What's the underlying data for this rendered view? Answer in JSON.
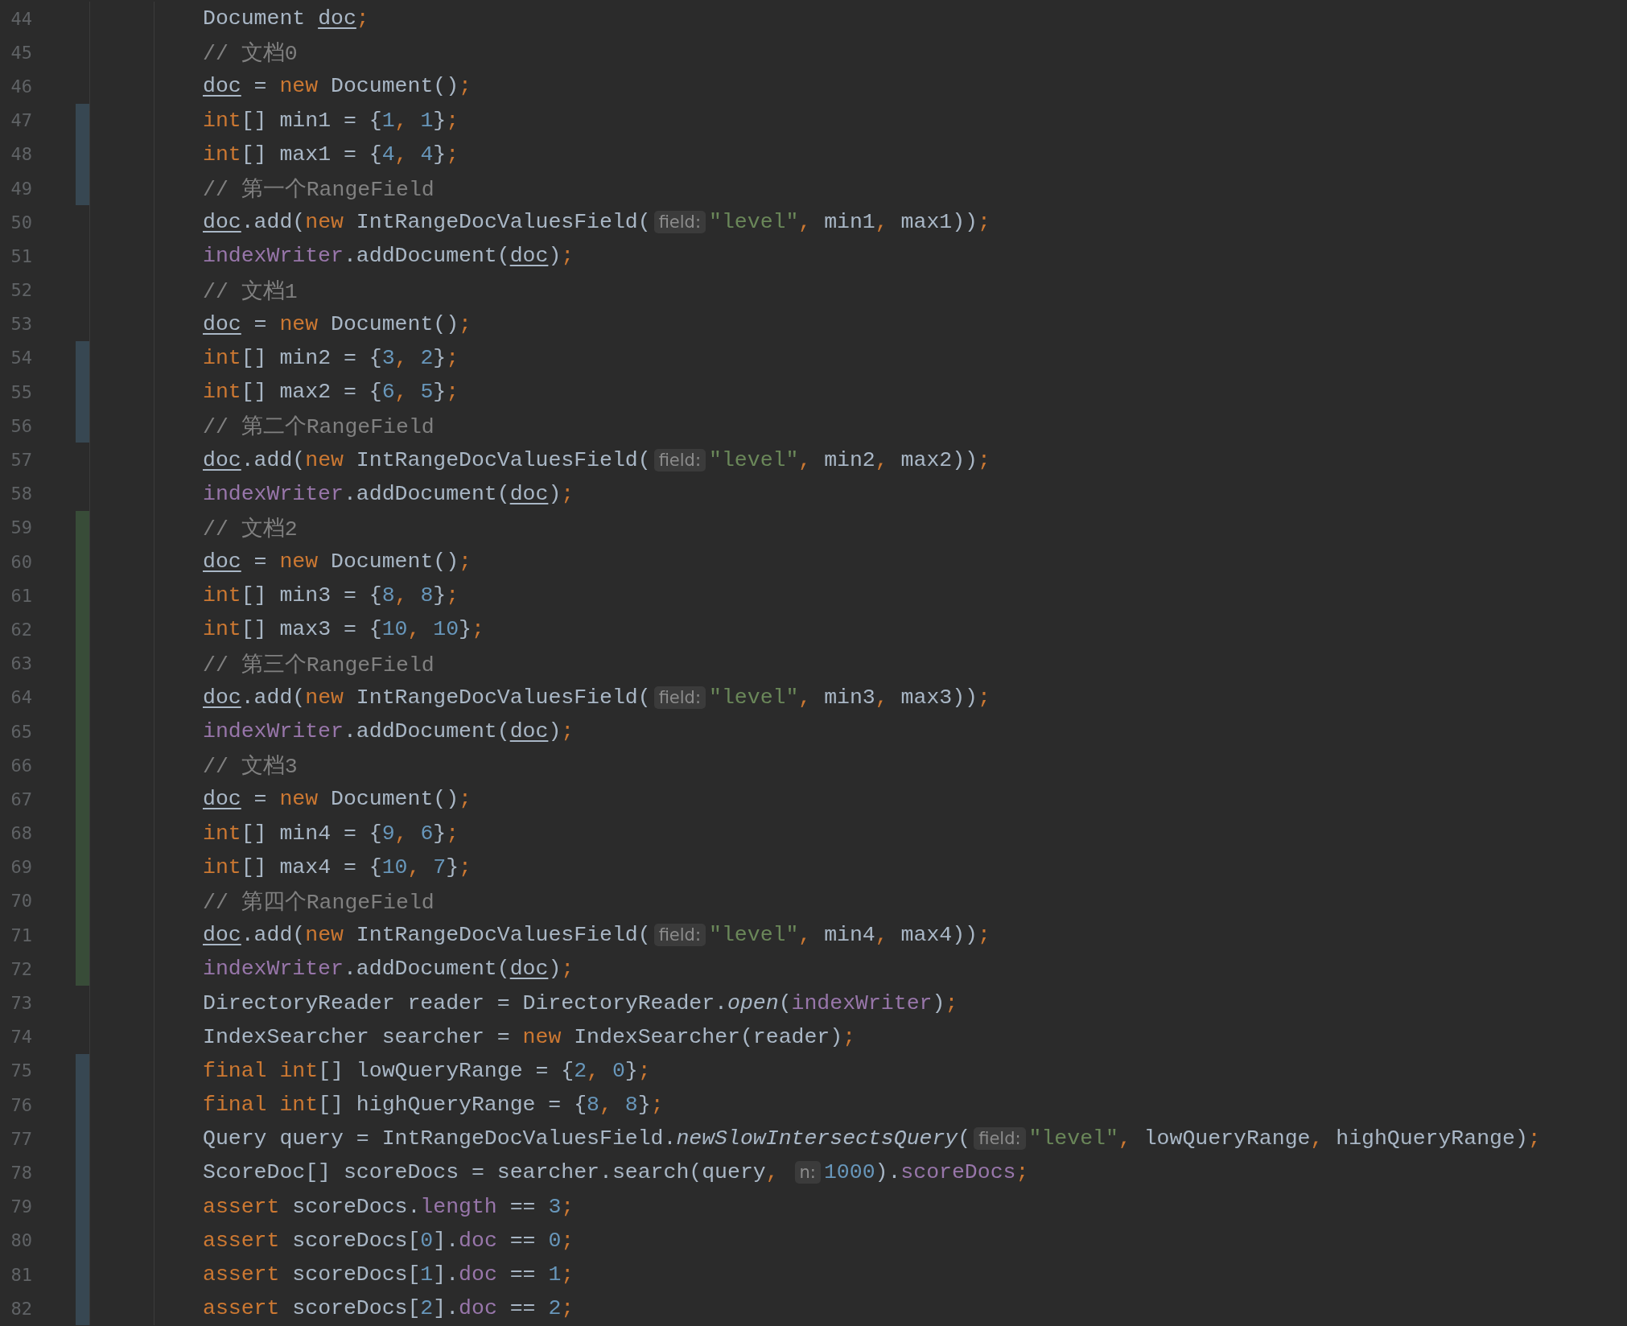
{
  "editor": {
    "lines": [
      {
        "number": "44",
        "kind": "unchanged",
        "tokens": [
          {
            "kind": "plain",
            "text": "Document "
          },
          {
            "kind": "var",
            "text": "doc"
          },
          {
            "kind": "punct",
            "text": ";"
          }
        ]
      },
      {
        "number": "45",
        "kind": "unchanged",
        "tokens": [
          {
            "kind": "comment",
            "text": "// 文档0"
          }
        ]
      },
      {
        "number": "46",
        "kind": "unchanged",
        "tokens": [
          {
            "kind": "var",
            "text": "doc"
          },
          {
            "kind": "plain",
            "text": " = "
          },
          {
            "kind": "keyword",
            "text": "new"
          },
          {
            "kind": "plain",
            "text": " Document()"
          },
          {
            "kind": "punct",
            "text": ";"
          }
        ]
      },
      {
        "number": "47",
        "kind": "modified",
        "tokens": [
          {
            "kind": "keyword",
            "text": "int"
          },
          {
            "kind": "plain",
            "text": "[] min1 = {"
          },
          {
            "kind": "number",
            "text": "1"
          },
          {
            "kind": "punct",
            "text": ", "
          },
          {
            "kind": "number",
            "text": "1"
          },
          {
            "kind": "plain",
            "text": "}"
          },
          {
            "kind": "punct",
            "text": ";"
          }
        ]
      },
      {
        "number": "48",
        "kind": "modified",
        "tokens": [
          {
            "kind": "keyword",
            "text": "int"
          },
          {
            "kind": "plain",
            "text": "[] max1 = {"
          },
          {
            "kind": "number",
            "text": "4"
          },
          {
            "kind": "punct",
            "text": ", "
          },
          {
            "kind": "number",
            "text": "4"
          },
          {
            "kind": "plain",
            "text": "}"
          },
          {
            "kind": "punct",
            "text": ";"
          }
        ]
      },
      {
        "number": "49",
        "kind": "modified",
        "tokens": [
          {
            "kind": "comment",
            "text": "// 第一个RangeField"
          }
        ]
      },
      {
        "number": "50",
        "kind": "unchanged",
        "tokens": [
          {
            "kind": "var",
            "text": "doc"
          },
          {
            "kind": "plain",
            "text": ".add("
          },
          {
            "kind": "keyword",
            "text": "new"
          },
          {
            "kind": "plain",
            "text": " IntRangeDocValuesField("
          },
          {
            "kind": "hint",
            "text": "field:"
          },
          {
            "kind": "string",
            "text": "\"level\""
          },
          {
            "kind": "punct",
            "text": ", "
          },
          {
            "kind": "plain",
            "text": "min1"
          },
          {
            "kind": "punct",
            "text": ", "
          },
          {
            "kind": "plain",
            "text": "max1))"
          },
          {
            "kind": "punct",
            "text": ";"
          }
        ]
      },
      {
        "number": "51",
        "kind": "unchanged",
        "tokens": [
          {
            "kind": "field",
            "text": "indexWriter"
          },
          {
            "kind": "plain",
            "text": ".addDocument("
          },
          {
            "kind": "var",
            "text": "doc"
          },
          {
            "kind": "plain",
            "text": ")"
          },
          {
            "kind": "punct",
            "text": ";"
          }
        ]
      },
      {
        "number": "52",
        "kind": "unchanged",
        "tokens": [
          {
            "kind": "comment",
            "text": "// 文档1"
          }
        ]
      },
      {
        "number": "53",
        "kind": "unchanged",
        "tokens": [
          {
            "kind": "var",
            "text": "doc"
          },
          {
            "kind": "plain",
            "text": " = "
          },
          {
            "kind": "keyword",
            "text": "new"
          },
          {
            "kind": "plain",
            "text": " Document()"
          },
          {
            "kind": "punct",
            "text": ";"
          }
        ]
      },
      {
        "number": "54",
        "kind": "modified",
        "tokens": [
          {
            "kind": "keyword",
            "text": "int"
          },
          {
            "kind": "plain",
            "text": "[] min2 = {"
          },
          {
            "kind": "number",
            "text": "3"
          },
          {
            "kind": "punct",
            "text": ", "
          },
          {
            "kind": "number",
            "text": "2"
          },
          {
            "kind": "plain",
            "text": "}"
          },
          {
            "kind": "punct",
            "text": ";"
          }
        ]
      },
      {
        "number": "55",
        "kind": "modified",
        "tokens": [
          {
            "kind": "keyword",
            "text": "int"
          },
          {
            "kind": "plain",
            "text": "[] max2 = {"
          },
          {
            "kind": "number",
            "text": "6"
          },
          {
            "kind": "punct",
            "text": ", "
          },
          {
            "kind": "number",
            "text": "5"
          },
          {
            "kind": "plain",
            "text": "}"
          },
          {
            "kind": "punct",
            "text": ";"
          }
        ]
      },
      {
        "number": "56",
        "kind": "modified",
        "tokens": [
          {
            "kind": "comment",
            "text": "// 第二个RangeField"
          }
        ]
      },
      {
        "number": "57",
        "kind": "unchanged",
        "tokens": [
          {
            "kind": "var",
            "text": "doc"
          },
          {
            "kind": "plain",
            "text": ".add("
          },
          {
            "kind": "keyword",
            "text": "new"
          },
          {
            "kind": "plain",
            "text": " IntRangeDocValuesField("
          },
          {
            "kind": "hint",
            "text": "field:"
          },
          {
            "kind": "string",
            "text": "\"level\""
          },
          {
            "kind": "punct",
            "text": ", "
          },
          {
            "kind": "plain",
            "text": "min2"
          },
          {
            "kind": "punct",
            "text": ", "
          },
          {
            "kind": "plain",
            "text": "max2))"
          },
          {
            "kind": "punct",
            "text": ";"
          }
        ]
      },
      {
        "number": "58",
        "kind": "unchanged",
        "tokens": [
          {
            "kind": "field",
            "text": "indexWriter"
          },
          {
            "kind": "plain",
            "text": ".addDocument("
          },
          {
            "kind": "var",
            "text": "doc"
          },
          {
            "kind": "plain",
            "text": ")"
          },
          {
            "kind": "punct",
            "text": ";"
          }
        ]
      },
      {
        "number": "59",
        "kind": "added",
        "tokens": [
          {
            "kind": "comment",
            "text": "// 文档2"
          }
        ]
      },
      {
        "number": "60",
        "kind": "added",
        "tokens": [
          {
            "kind": "var",
            "text": "doc"
          },
          {
            "kind": "plain",
            "text": " = "
          },
          {
            "kind": "keyword",
            "text": "new"
          },
          {
            "kind": "plain",
            "text": " Document()"
          },
          {
            "kind": "punct",
            "text": ";"
          }
        ]
      },
      {
        "number": "61",
        "kind": "added",
        "tokens": [
          {
            "kind": "keyword",
            "text": "int"
          },
          {
            "kind": "plain",
            "text": "[] min3 = {"
          },
          {
            "kind": "number",
            "text": "8"
          },
          {
            "kind": "punct",
            "text": ", "
          },
          {
            "kind": "number",
            "text": "8"
          },
          {
            "kind": "plain",
            "text": "}"
          },
          {
            "kind": "punct",
            "text": ";"
          }
        ]
      },
      {
        "number": "62",
        "kind": "added",
        "tokens": [
          {
            "kind": "keyword",
            "text": "int"
          },
          {
            "kind": "plain",
            "text": "[] max3 = {"
          },
          {
            "kind": "number",
            "text": "10"
          },
          {
            "kind": "punct",
            "text": ", "
          },
          {
            "kind": "number",
            "text": "10"
          },
          {
            "kind": "plain",
            "text": "}"
          },
          {
            "kind": "punct",
            "text": ";"
          }
        ]
      },
      {
        "number": "63",
        "kind": "added",
        "tokens": [
          {
            "kind": "comment",
            "text": "// 第三个RangeField"
          }
        ]
      },
      {
        "number": "64",
        "kind": "added",
        "tokens": [
          {
            "kind": "var",
            "text": "doc"
          },
          {
            "kind": "plain",
            "text": ".add("
          },
          {
            "kind": "keyword",
            "text": "new"
          },
          {
            "kind": "plain",
            "text": " IntRangeDocValuesField("
          },
          {
            "kind": "hint",
            "text": "field:"
          },
          {
            "kind": "string",
            "text": "\"level\""
          },
          {
            "kind": "punct",
            "text": ", "
          },
          {
            "kind": "plain",
            "text": "min3"
          },
          {
            "kind": "punct",
            "text": ", "
          },
          {
            "kind": "plain",
            "text": "max3))"
          },
          {
            "kind": "punct",
            "text": ";"
          }
        ]
      },
      {
        "number": "65",
        "kind": "added",
        "tokens": [
          {
            "kind": "field",
            "text": "indexWriter"
          },
          {
            "kind": "plain",
            "text": ".addDocument("
          },
          {
            "kind": "var",
            "text": "doc"
          },
          {
            "kind": "plain",
            "text": ")"
          },
          {
            "kind": "punct",
            "text": ";"
          }
        ]
      },
      {
        "number": "66",
        "kind": "added",
        "tokens": [
          {
            "kind": "comment",
            "text": "// 文档3"
          }
        ]
      },
      {
        "number": "67",
        "kind": "added",
        "tokens": [
          {
            "kind": "var",
            "text": "doc"
          },
          {
            "kind": "plain",
            "text": " = "
          },
          {
            "kind": "keyword",
            "text": "new"
          },
          {
            "kind": "plain",
            "text": " Document()"
          },
          {
            "kind": "punct",
            "text": ";"
          }
        ]
      },
      {
        "number": "68",
        "kind": "added",
        "tokens": [
          {
            "kind": "keyword",
            "text": "int"
          },
          {
            "kind": "plain",
            "text": "[] min4 = {"
          },
          {
            "kind": "number",
            "text": "9"
          },
          {
            "kind": "punct",
            "text": ", "
          },
          {
            "kind": "number",
            "text": "6"
          },
          {
            "kind": "plain",
            "text": "}"
          },
          {
            "kind": "punct",
            "text": ";"
          }
        ]
      },
      {
        "number": "69",
        "kind": "added",
        "tokens": [
          {
            "kind": "keyword",
            "text": "int"
          },
          {
            "kind": "plain",
            "text": "[] max4 = {"
          },
          {
            "kind": "number",
            "text": "10"
          },
          {
            "kind": "punct",
            "text": ", "
          },
          {
            "kind": "number",
            "text": "7"
          },
          {
            "kind": "plain",
            "text": "}"
          },
          {
            "kind": "punct",
            "text": ";"
          }
        ]
      },
      {
        "number": "70",
        "kind": "added",
        "tokens": [
          {
            "kind": "comment",
            "text": "// 第四个RangeField"
          }
        ]
      },
      {
        "number": "71",
        "kind": "added",
        "tokens": [
          {
            "kind": "var",
            "text": "doc"
          },
          {
            "kind": "plain",
            "text": ".add("
          },
          {
            "kind": "keyword",
            "text": "new"
          },
          {
            "kind": "plain",
            "text": " IntRangeDocValuesField("
          },
          {
            "kind": "hint",
            "text": "field:"
          },
          {
            "kind": "string",
            "text": "\"level\""
          },
          {
            "kind": "punct",
            "text": ", "
          },
          {
            "kind": "plain",
            "text": "min4"
          },
          {
            "kind": "punct",
            "text": ", "
          },
          {
            "kind": "plain",
            "text": "max4))"
          },
          {
            "kind": "punct",
            "text": ";"
          }
        ]
      },
      {
        "number": "72",
        "kind": "added",
        "tokens": [
          {
            "kind": "field",
            "text": "indexWriter"
          },
          {
            "kind": "plain",
            "text": ".addDocument("
          },
          {
            "kind": "var",
            "text": "doc"
          },
          {
            "kind": "plain",
            "text": ")"
          },
          {
            "kind": "punct",
            "text": ";"
          }
        ]
      },
      {
        "number": "73",
        "kind": "unchanged",
        "tokens": [
          {
            "kind": "plain",
            "text": "DirectoryReader reader = DirectoryReader."
          },
          {
            "kind": "static",
            "text": "open"
          },
          {
            "kind": "plain",
            "text": "("
          },
          {
            "kind": "field",
            "text": "indexWriter"
          },
          {
            "kind": "plain",
            "text": ")"
          },
          {
            "kind": "punct",
            "text": ";"
          }
        ]
      },
      {
        "number": "74",
        "kind": "unchanged",
        "tokens": [
          {
            "kind": "plain",
            "text": "IndexSearcher searcher = "
          },
          {
            "kind": "keyword",
            "text": "new"
          },
          {
            "kind": "plain",
            "text": " IndexSearcher(reader)"
          },
          {
            "kind": "punct",
            "text": ";"
          }
        ]
      },
      {
        "number": "75",
        "kind": "modified",
        "tokens": [
          {
            "kind": "keyword",
            "text": "final int"
          },
          {
            "kind": "plain",
            "text": "[] lowQueryRange = {"
          },
          {
            "kind": "number",
            "text": "2"
          },
          {
            "kind": "punct",
            "text": ", "
          },
          {
            "kind": "number",
            "text": "0"
          },
          {
            "kind": "plain",
            "text": "}"
          },
          {
            "kind": "punct",
            "text": ";"
          }
        ]
      },
      {
        "number": "76",
        "kind": "modified",
        "tokens": [
          {
            "kind": "keyword",
            "text": "final int"
          },
          {
            "kind": "plain",
            "text": "[] highQueryRange = {"
          },
          {
            "kind": "number",
            "text": "8"
          },
          {
            "kind": "punct",
            "text": ", "
          },
          {
            "kind": "number",
            "text": "8"
          },
          {
            "kind": "plain",
            "text": "}"
          },
          {
            "kind": "punct",
            "text": ";"
          }
        ]
      },
      {
        "number": "77",
        "kind": "modified",
        "tokens": [
          {
            "kind": "plain",
            "text": "Query query = IntRangeDocValuesField."
          },
          {
            "kind": "static",
            "text": "newSlowIntersectsQuery"
          },
          {
            "kind": "plain",
            "text": "("
          },
          {
            "kind": "hint",
            "text": "field:"
          },
          {
            "kind": "string",
            "text": "\"level\""
          },
          {
            "kind": "punct",
            "text": ", "
          },
          {
            "kind": "plain",
            "text": "lowQueryRange"
          },
          {
            "kind": "punct",
            "text": ", "
          },
          {
            "kind": "plain",
            "text": "highQueryRange)"
          },
          {
            "kind": "punct",
            "text": ";"
          }
        ]
      },
      {
        "number": "78",
        "kind": "modified",
        "tokens": [
          {
            "kind": "plain",
            "text": "ScoreDoc[] scoreDocs = searcher.search(query"
          },
          {
            "kind": "punct",
            "text": ", "
          },
          {
            "kind": "hint",
            "text": "n:"
          },
          {
            "kind": "number",
            "text": "1000"
          },
          {
            "kind": "plain",
            "text": ")."
          },
          {
            "kind": "field",
            "text": "scoreDocs"
          },
          {
            "kind": "punct",
            "text": ";"
          }
        ]
      },
      {
        "number": "79",
        "kind": "modified",
        "tokens": [
          {
            "kind": "keyword",
            "text": "assert"
          },
          {
            "kind": "plain",
            "text": " scoreDocs."
          },
          {
            "kind": "field",
            "text": "length"
          },
          {
            "kind": "plain",
            "text": " == "
          },
          {
            "kind": "number",
            "text": "3"
          },
          {
            "kind": "punct",
            "text": ";"
          }
        ]
      },
      {
        "number": "80",
        "kind": "modified",
        "tokens": [
          {
            "kind": "keyword",
            "text": "assert"
          },
          {
            "kind": "plain",
            "text": " scoreDocs["
          },
          {
            "kind": "number",
            "text": "0"
          },
          {
            "kind": "plain",
            "text": "]."
          },
          {
            "kind": "field",
            "text": "doc"
          },
          {
            "kind": "plain",
            "text": " == "
          },
          {
            "kind": "number",
            "text": "0"
          },
          {
            "kind": "punct",
            "text": ";"
          }
        ]
      },
      {
        "number": "81",
        "kind": "modified",
        "tokens": [
          {
            "kind": "keyword",
            "text": "assert"
          },
          {
            "kind": "plain",
            "text": " scoreDocs["
          },
          {
            "kind": "number",
            "text": "1"
          },
          {
            "kind": "plain",
            "text": "]."
          },
          {
            "kind": "field",
            "text": "doc"
          },
          {
            "kind": "plain",
            "text": " == "
          },
          {
            "kind": "number",
            "text": "1"
          },
          {
            "kind": "punct",
            "text": ";"
          }
        ]
      },
      {
        "number": "82",
        "kind": "modified",
        "tokens": [
          {
            "kind": "keyword",
            "text": "assert"
          },
          {
            "kind": "plain",
            "text": " scoreDocs["
          },
          {
            "kind": "number",
            "text": "2"
          },
          {
            "kind": "plain",
            "text": "]."
          },
          {
            "kind": "field",
            "text": "doc"
          },
          {
            "kind": "plain",
            "text": " == "
          },
          {
            "kind": "number",
            "text": "2"
          },
          {
            "kind": "punct",
            "text": ";"
          }
        ]
      }
    ]
  }
}
